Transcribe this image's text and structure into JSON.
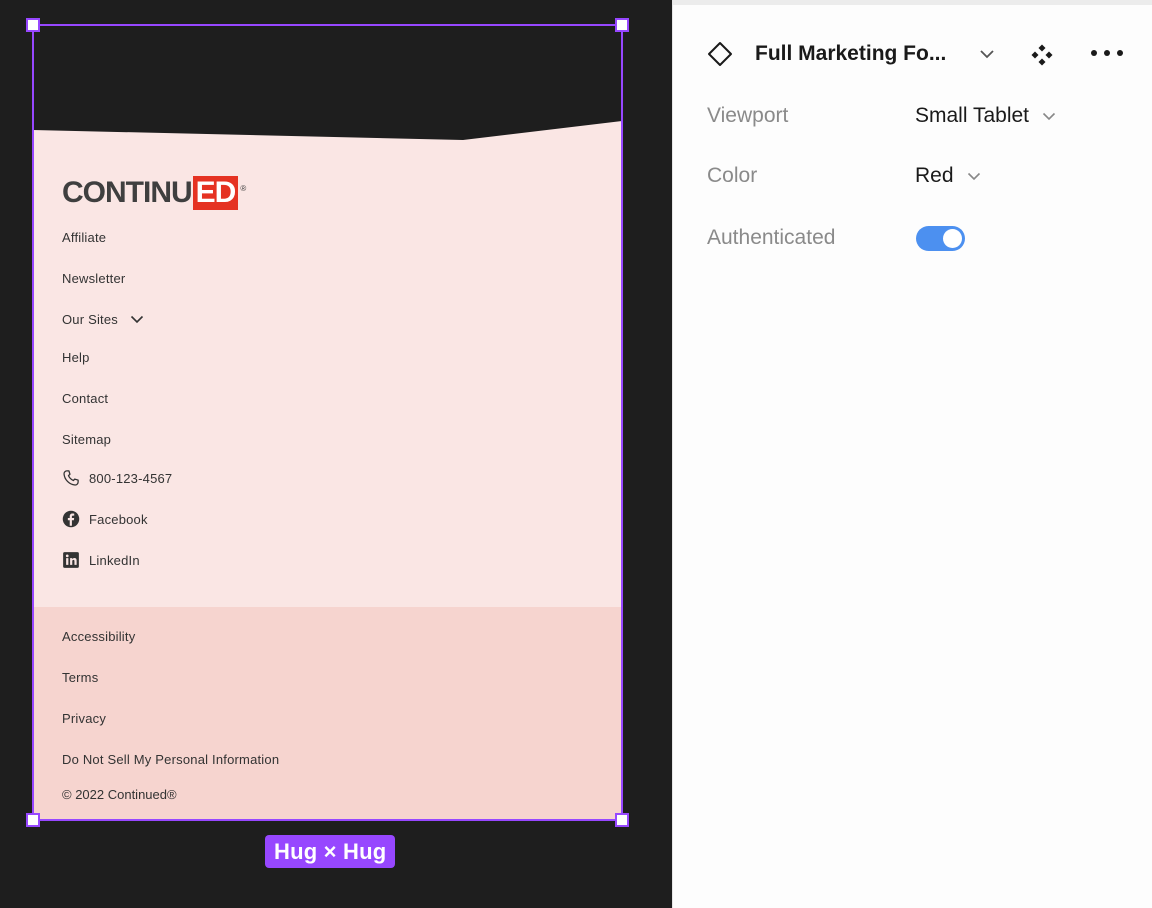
{
  "canvas": {
    "hug_label": "Hug × Hug",
    "footer": {
      "logo": {
        "word": "CONTINU",
        "ed": "ED",
        "reg": "®"
      },
      "links": [
        "Affiliate",
        "Newsletter",
        "Our Sites",
        "Help",
        "Contact",
        "Sitemap"
      ],
      "phone": "800-123-4567",
      "facebook": "Facebook",
      "linkedin": "LinkedIn",
      "legal_links": [
        "Accessibility",
        "Terms",
        "Privacy",
        "Do Not Sell My Personal Information"
      ],
      "copyright": "© 2022 Continued®"
    },
    "colors": {
      "frame_bg": "#fae6e4",
      "frame_bottom_bg": "#f6d4cf",
      "selection": "#9747ff",
      "logo_red": "#e53222"
    }
  },
  "panel": {
    "component_title": "Full Marketing Fo...",
    "properties": [
      {
        "label": "Viewport",
        "value": "Small Tablet"
      },
      {
        "label": "Color",
        "value": "Red"
      },
      {
        "label": "Authenticated",
        "toggle": true
      }
    ],
    "colors": {
      "toggle_on": "#4c90f0"
    }
  }
}
